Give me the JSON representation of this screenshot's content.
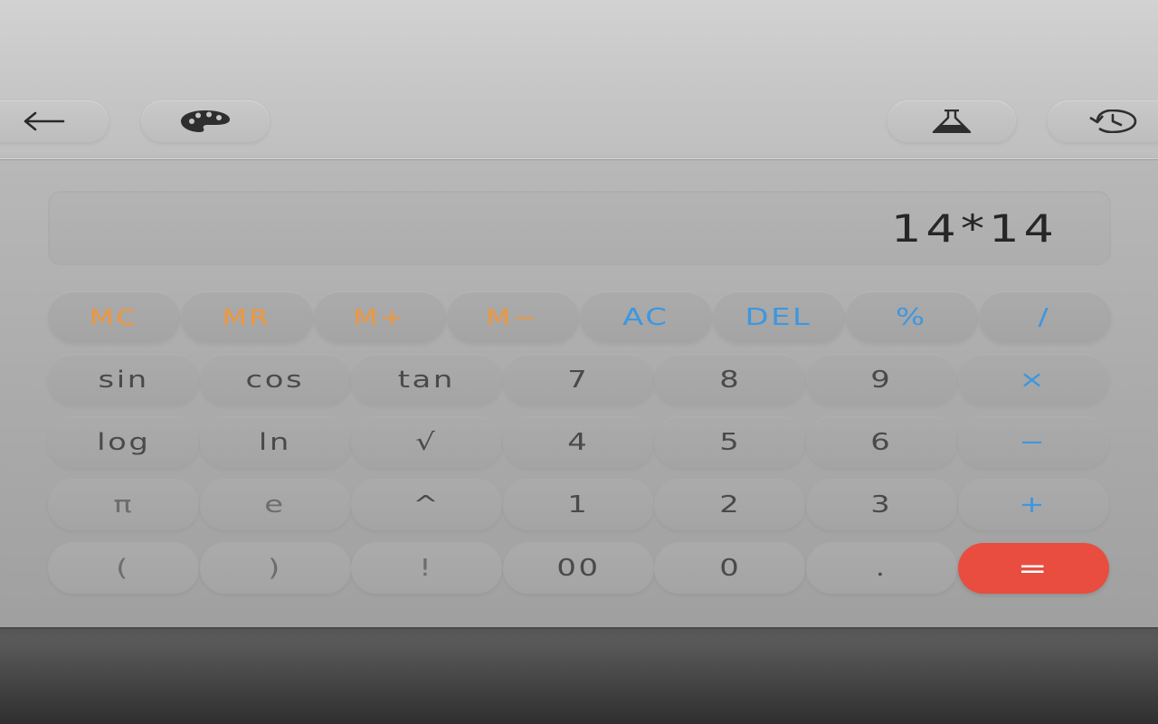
{
  "toolbar": {
    "back_icon": "arrow-left-icon",
    "theme_icon": "palette-icon",
    "scientific_icon": "flask-icon",
    "history_icon": "history-icon"
  },
  "display": {
    "expression": "14*14"
  },
  "memory_row": [
    {
      "label": "MC",
      "kind": "mem"
    },
    {
      "label": "MR",
      "kind": "mem"
    },
    {
      "label": "M+",
      "kind": "mem"
    },
    {
      "label": "M−",
      "kind": "mem"
    },
    {
      "label": "AC",
      "kind": "op"
    },
    {
      "label": "DEL",
      "kind": "op"
    },
    {
      "label": "%",
      "kind": "op"
    },
    {
      "label": "/",
      "kind": "op"
    }
  ],
  "keypad_rows": [
    [
      "sin",
      "cos",
      "tan",
      "7",
      "8",
      "9",
      "×"
    ],
    [
      "log",
      "ln",
      "√",
      "4",
      "5",
      "6",
      "−"
    ],
    [
      "π",
      "e",
      "^",
      "1",
      "2",
      "3",
      "+"
    ],
    [
      "(",
      ")",
      "!",
      "00",
      "0",
      ".",
      "="
    ]
  ],
  "colors": {
    "memory": "#f0963a",
    "operator": "#3d97e0",
    "equals": "#e84d3f",
    "text": "#4a4a4a"
  }
}
